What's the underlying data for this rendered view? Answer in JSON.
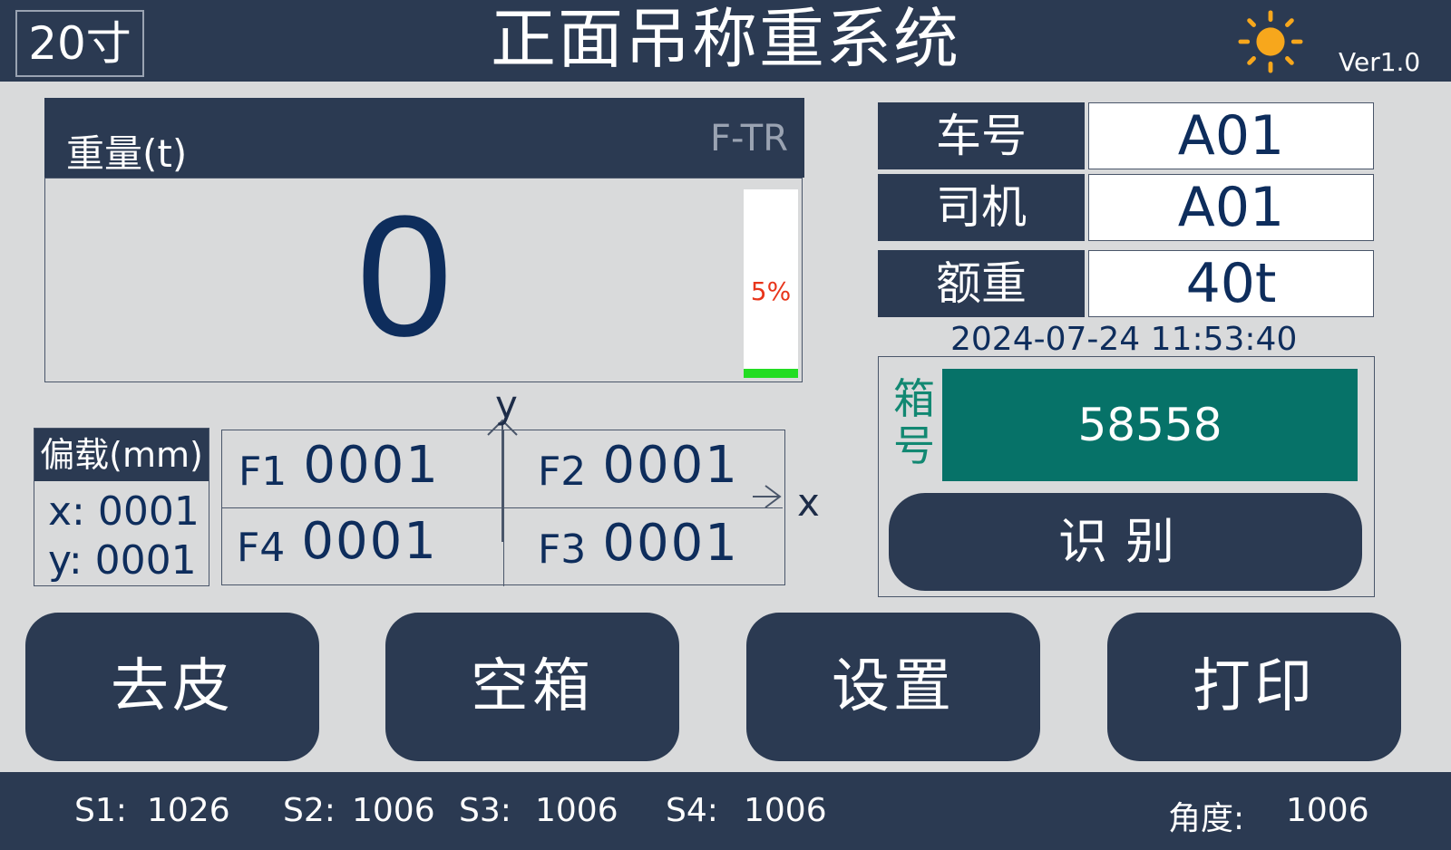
{
  "header": {
    "size_badge": "20寸",
    "title": "正面吊称重系统",
    "version": "Ver1.0",
    "brightness_icon": "sun-icon"
  },
  "weight": {
    "label": "重量(t)",
    "mode": "F-TR",
    "value": "0",
    "load_percent_text": "5%",
    "load_fraction": 0.05
  },
  "eccentric": {
    "title": "偏载(mm)",
    "x": "x: 0001",
    "y": "y: 0001"
  },
  "forces": {
    "f1_label": "F1",
    "f1_value": "0001",
    "f2_label": "F2",
    "f2_value": "0001",
    "f3_label": "F3",
    "f3_value": "0001",
    "f4_label": "F4",
    "f4_value": "0001",
    "axis_x": "x",
    "axis_y": "y"
  },
  "info": {
    "truck_label": "车号",
    "truck_value": "A01",
    "driver_label": "司机",
    "driver_value": "A01",
    "rated_label": "额重",
    "rated_value": "40t",
    "datetime": "2024-07-24 11:53:40"
  },
  "container": {
    "label": "箱号",
    "number": "58558",
    "recognize_label": "识别"
  },
  "buttons": {
    "tare": "去皮",
    "empty": "空箱",
    "settings": "设置",
    "print": "打印"
  },
  "status": {
    "s1_label": "S1:",
    "s1_value": "1026",
    "s2_label": "S2:",
    "s2_value": "1006",
    "s3_label": "S3:",
    "s3_value": "1006",
    "s4_label": "S4:",
    "s4_value": "1006",
    "angle_label": "角度:",
    "angle_value": "1006"
  },
  "colors": {
    "navy": "#2b3a52",
    "teal": "#067268",
    "value_blue": "#0e2d5c",
    "bar_green": "#22dd22",
    "percent_red": "#e8351b"
  }
}
